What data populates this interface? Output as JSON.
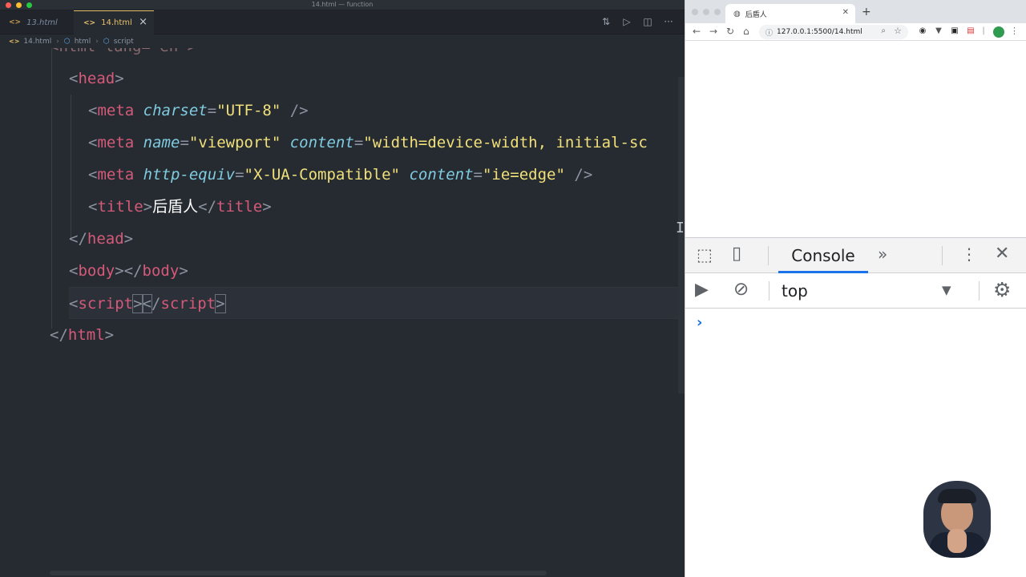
{
  "editor": {
    "window_title": "14.html — function",
    "tabs": [
      {
        "label": "13.html",
        "active": false
      },
      {
        "label": "14.html",
        "active": true
      }
    ],
    "breadcrumb": [
      "14.html",
      "html",
      "script"
    ],
    "code": {
      "line0_partial": "<html lang=\"en\">",
      "head_open": "head",
      "meta1": {
        "tag": "meta",
        "attr": "charset",
        "value": "\"UTF-8\""
      },
      "meta2": {
        "tag": "meta",
        "attr1": "name",
        "value1": "\"viewport\"",
        "attr2": "content",
        "value2": "\"width=device-width, initial-sc"
      },
      "meta3": {
        "tag": "meta",
        "attr1": "http-equiv",
        "value1": "\"X-UA-Compatible\"",
        "attr2": "content",
        "value2": "\"ie=edge\""
      },
      "title_tag": "title",
      "title_text": "后盾人",
      "head_close": "head",
      "body_tag": "body",
      "script_tag": "script",
      "html_close": "html"
    }
  },
  "browser": {
    "tab_title": "后盾人",
    "url": "127.0.0.1:5500/14.html",
    "devtools": {
      "active_tab": "Console",
      "context": "top",
      "prompt": "›"
    }
  },
  "colors": {
    "editor_bg": "#262a31",
    "tag": "#d55a7a",
    "attr": "#7fcce0",
    "string": "#f0e07a",
    "devtools_accent": "#1a73e8"
  }
}
